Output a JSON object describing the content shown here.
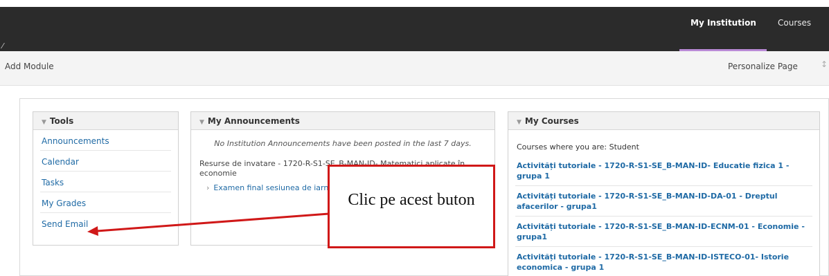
{
  "topbar": {
    "pin_icon": "pin-icon",
    "tabs": [
      {
        "label": "My Institution",
        "active": true
      },
      {
        "label": "Courses",
        "active": false
      }
    ],
    "active_color": "#b98ad6"
  },
  "subbar": {
    "add_module": "Add Module",
    "personalize": "Personalize Page",
    "reorder_icon": "reorder-icon"
  },
  "tools": {
    "title": "Tools",
    "items": [
      "Announcements",
      "Calendar",
      "Tasks",
      "My Grades",
      "Send Email"
    ]
  },
  "announcements": {
    "title": "My Announcements",
    "empty_message": "No Institution Announcements have been posted in the last 7 days.",
    "course_name": "Resurse de invatare - 1720-R-S1-SE_B-MAN-ID- Matematici aplicate în economie",
    "link": "Examen final sesiunea de iarna"
  },
  "courses": {
    "title": "My Courses",
    "role_line": "Courses where you are: Student",
    "items": [
      "Activități tutoriale - 1720-R-S1-SE_B-MAN-ID- Educatie fizica 1 - grupa 1",
      "Activități tutoriale - 1720-R-S1-SE_B-MAN-ID-DA-01 - Dreptul afacerilor - grupa1",
      "Activități tutoriale - 1720-R-S1-SE_B-MAN-ID-ECNM-01 - Economie - grupa1",
      "Activități tutoriale - 1720-R-S1-SE_B-MAN-ID-ISTECO-01- Istorie economica - grupa 1"
    ]
  },
  "callout": {
    "text": "Clic pe acest buton",
    "border_color": "#d01818"
  },
  "colors": {
    "link": "#1f6aa5",
    "topbar": "#2b2b2b"
  }
}
